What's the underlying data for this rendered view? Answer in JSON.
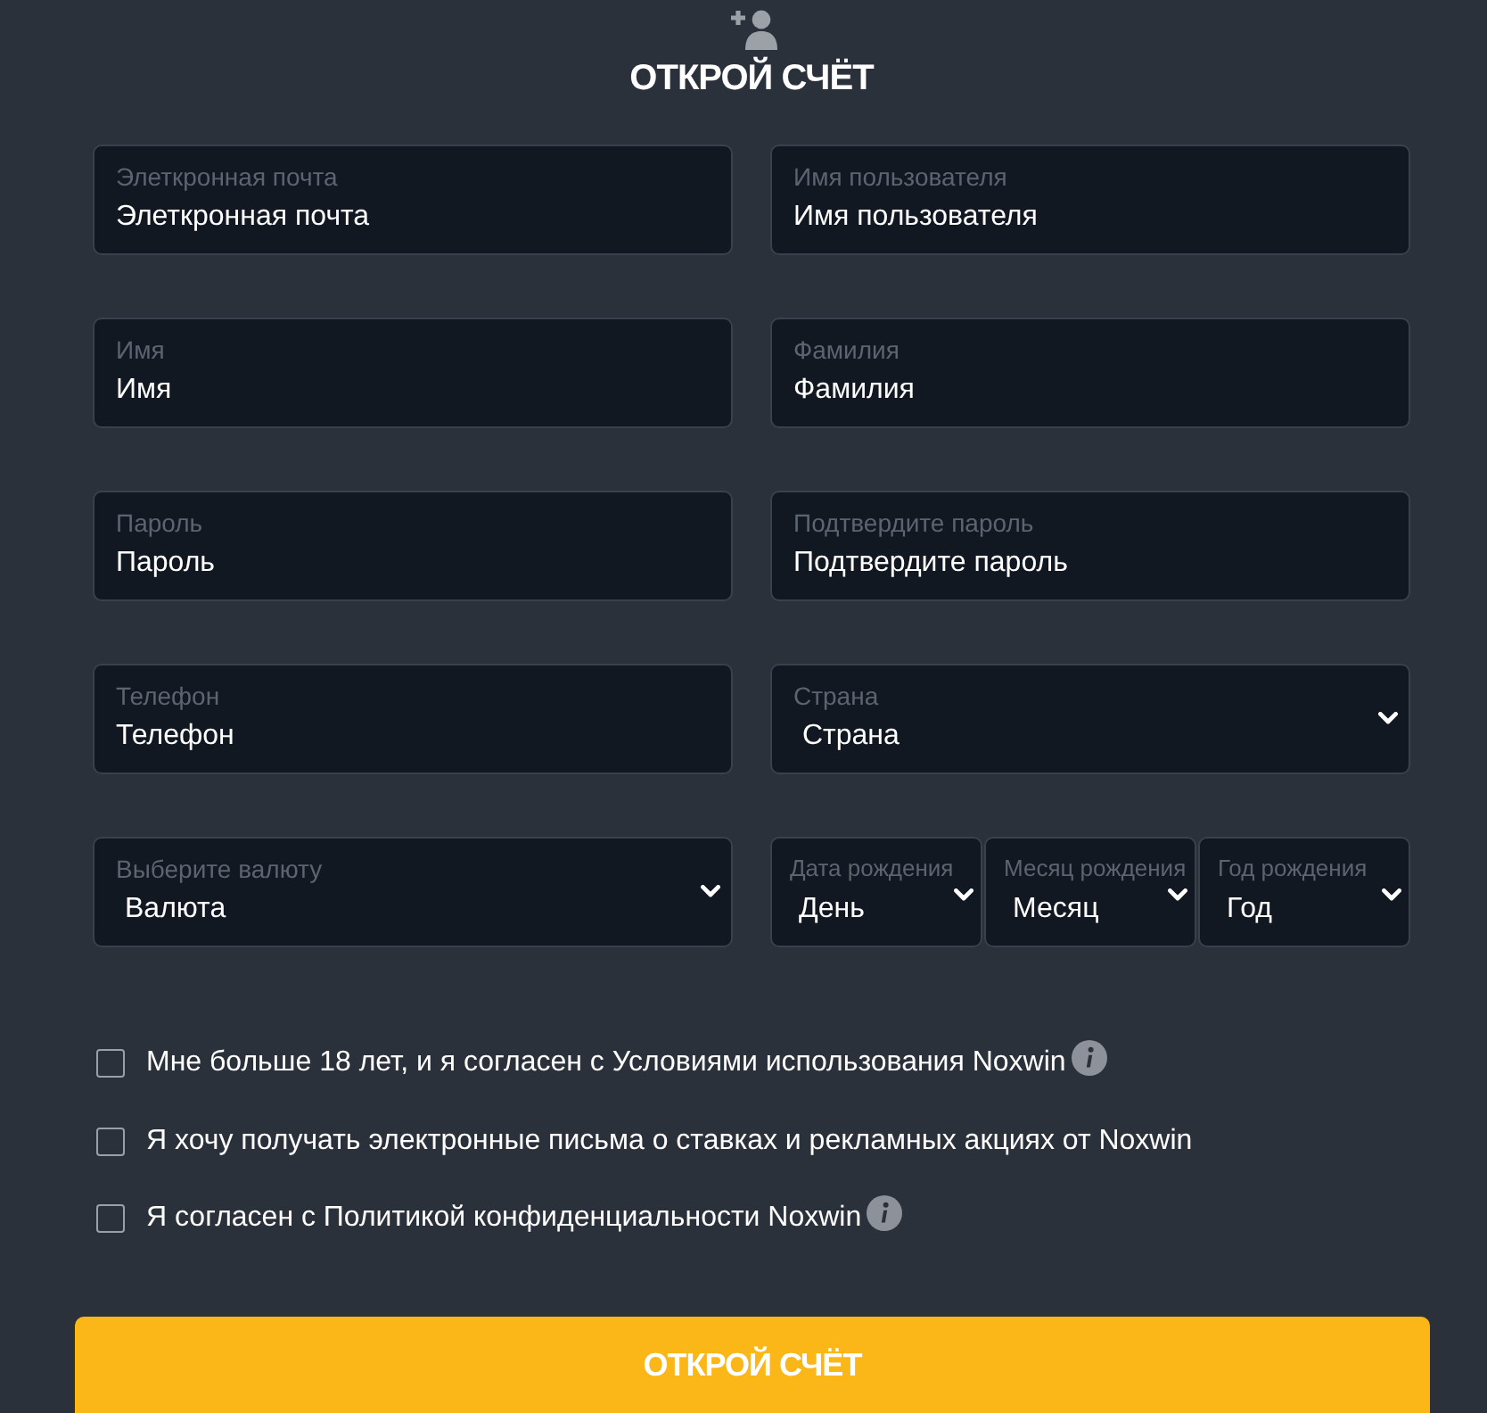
{
  "header": {
    "title": "ОТКРОЙ СЧЁТ"
  },
  "rows": [
    [
      {
        "kind": "text",
        "label": "Элеткронная почта",
        "placeholder": "Элеткронная почта"
      },
      {
        "kind": "text",
        "label": "Имя пользователя",
        "placeholder": "Имя пользователя"
      }
    ],
    [
      {
        "kind": "text",
        "label": "Имя",
        "placeholder": "Имя"
      },
      {
        "kind": "text",
        "label": "Фамилия",
        "placeholder": "Фамилия"
      }
    ],
    [
      {
        "kind": "text",
        "label": "Пароль",
        "placeholder": "Пароль"
      },
      {
        "kind": "text",
        "label": "Подтвердите пароль",
        "placeholder": "Подтвердите пароль"
      }
    ],
    [
      {
        "kind": "text",
        "label": "Телефон",
        "placeholder": "Телефон"
      },
      {
        "kind": "select",
        "label": "Страна",
        "value": "Страна"
      }
    ],
    [
      {
        "kind": "select",
        "label": "Выберите валюту",
        "value": "Валюта"
      },
      {
        "kind": "date",
        "parts": [
          {
            "label": "Дата рождения",
            "value": "День"
          },
          {
            "label": "Месяц рождения",
            "value": "Месяц"
          },
          {
            "label": "Год рождения",
            "value": "Год"
          }
        ]
      }
    ]
  ],
  "agreements": [
    {
      "label": "Мне больше 18 лет, и я согласен с Условиями использования Noxwin",
      "checked": false,
      "info": true
    },
    {
      "label": "Я хочу получать электронные письма о ставках и рекламных акциях от Noxwin",
      "checked": false,
      "info": false
    },
    {
      "label": "Я согласен с Политикой конфиденциальности Noxwin",
      "checked": false,
      "info": true
    }
  ],
  "submit": {
    "label": "ОТКРОЙ СЧЁТ"
  }
}
